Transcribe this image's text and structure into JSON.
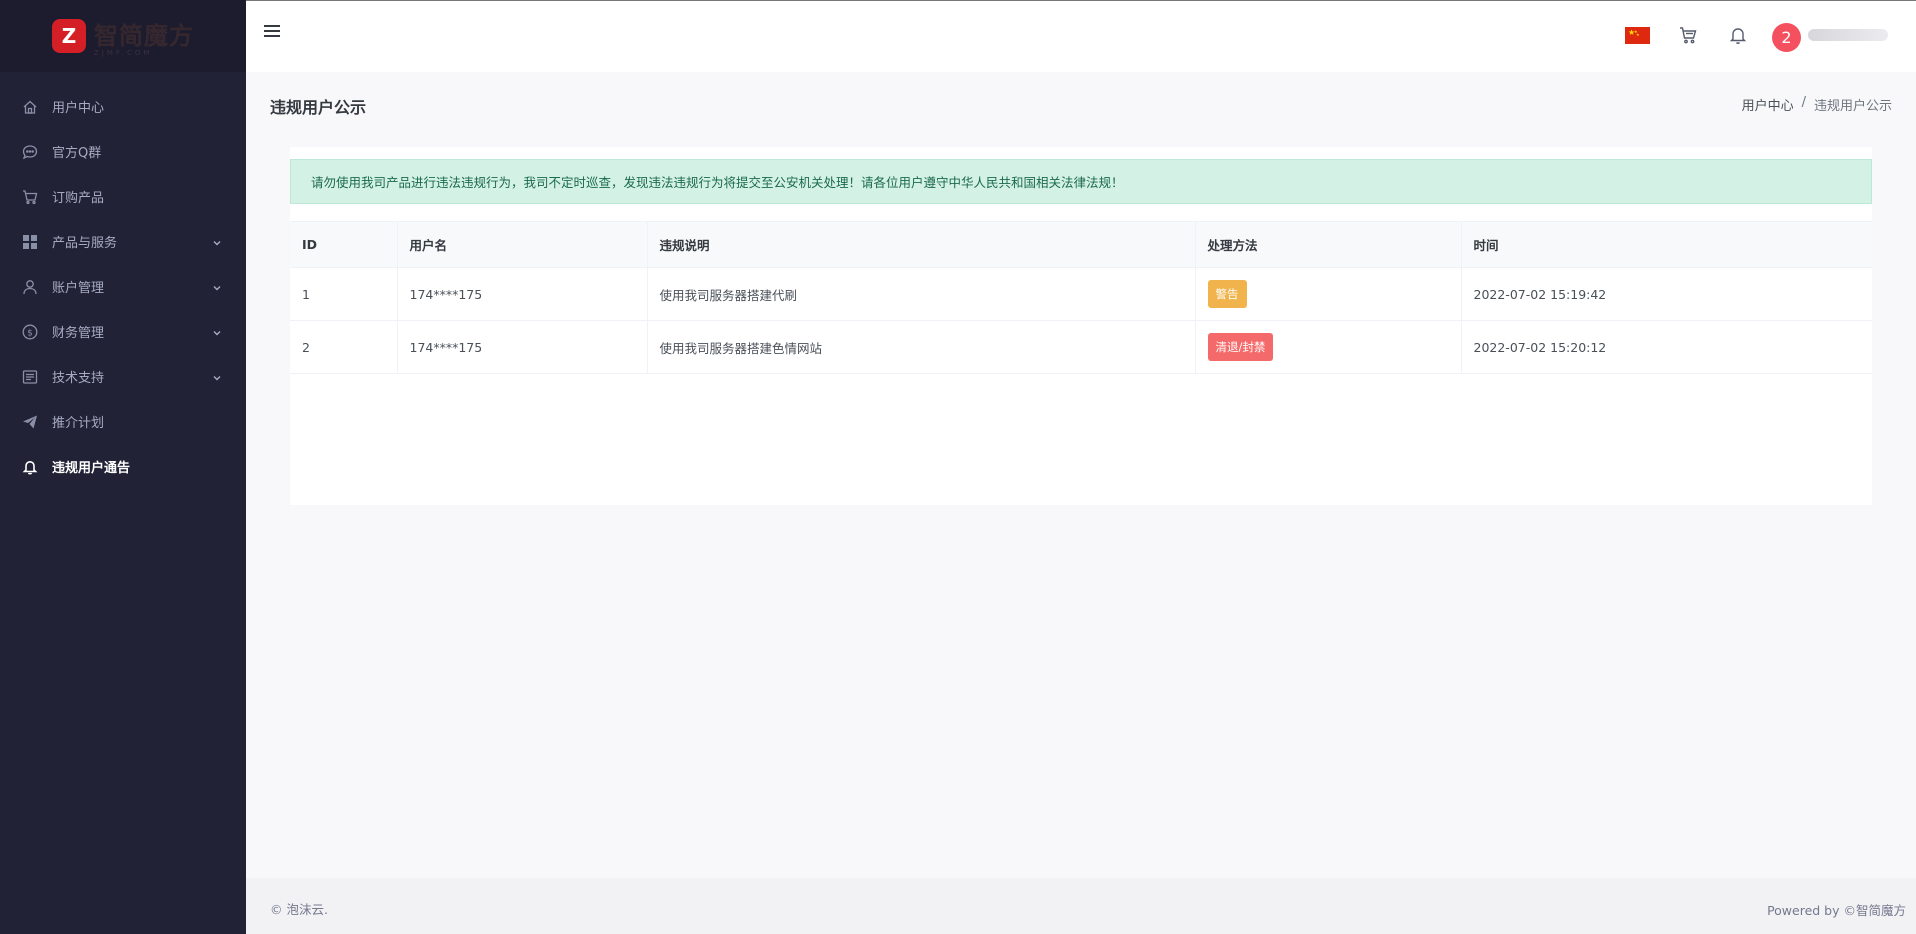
{
  "brand": {
    "logo_letter": "Z",
    "name_cn": "智简魔方",
    "name_en": "ZJMF.COM"
  },
  "sidebar": {
    "items": [
      {
        "label": "用户中心",
        "icon": "home-icon",
        "chevron": false,
        "active": false
      },
      {
        "label": "官方Q群",
        "icon": "chat-icon",
        "chevron": false,
        "active": false
      },
      {
        "label": "订购产品",
        "icon": "cart-icon",
        "chevron": false,
        "active": false
      },
      {
        "label": "产品与服务",
        "icon": "grid-icon",
        "chevron": true,
        "active": false
      },
      {
        "label": "账户管理",
        "icon": "user-icon",
        "chevron": true,
        "active": false
      },
      {
        "label": "财务管理",
        "icon": "dollar-icon",
        "chevron": true,
        "active": false
      },
      {
        "label": "技术支持",
        "icon": "ticket-icon",
        "chevron": true,
        "active": false
      },
      {
        "label": "推介计划",
        "icon": "send-icon",
        "chevron": false,
        "active": false
      },
      {
        "label": "违规用户通告",
        "icon": "bell-icon",
        "chevron": false,
        "active": true
      }
    ]
  },
  "header": {
    "avatar_text": "2",
    "user_name": "2201000000"
  },
  "page": {
    "title": "违规用户公示",
    "breadcrumb": [
      "用户中心",
      "/",
      "违规用户公示"
    ]
  },
  "alert": {
    "text": "请勿使用我司产品进行违法违规行为，我司不定时巡查，发现违法违规行为将提交至公安机关处理！请各位用户遵守中华人民共和国相关法律法规！"
  },
  "table": {
    "columns": [
      "ID",
      "用户名",
      "违规说明",
      "处理方法",
      "时间"
    ],
    "rows": [
      {
        "id": "1",
        "user": "174****175",
        "desc": "使用我司服务器搭建代刷",
        "action": "警告",
        "action_type": "warn",
        "time": "2022-07-02 15:19:42"
      },
      {
        "id": "2",
        "user": "174****175",
        "desc": "使用我司服务器搭建色情网站",
        "action": "清退/封禁",
        "action_type": "ban",
        "time": "2022-07-02 15:20:12"
      }
    ]
  },
  "footer": {
    "left": "© 泡沫云.",
    "right": "Powered by ©智简魔方"
  },
  "colors": {
    "sidebar_bg": "#222236",
    "alert_bg": "#d4f1e6",
    "badge_warn": "#f1b44c",
    "badge_ban": "#f46a6a",
    "avatar_bg": "#f4505f"
  }
}
